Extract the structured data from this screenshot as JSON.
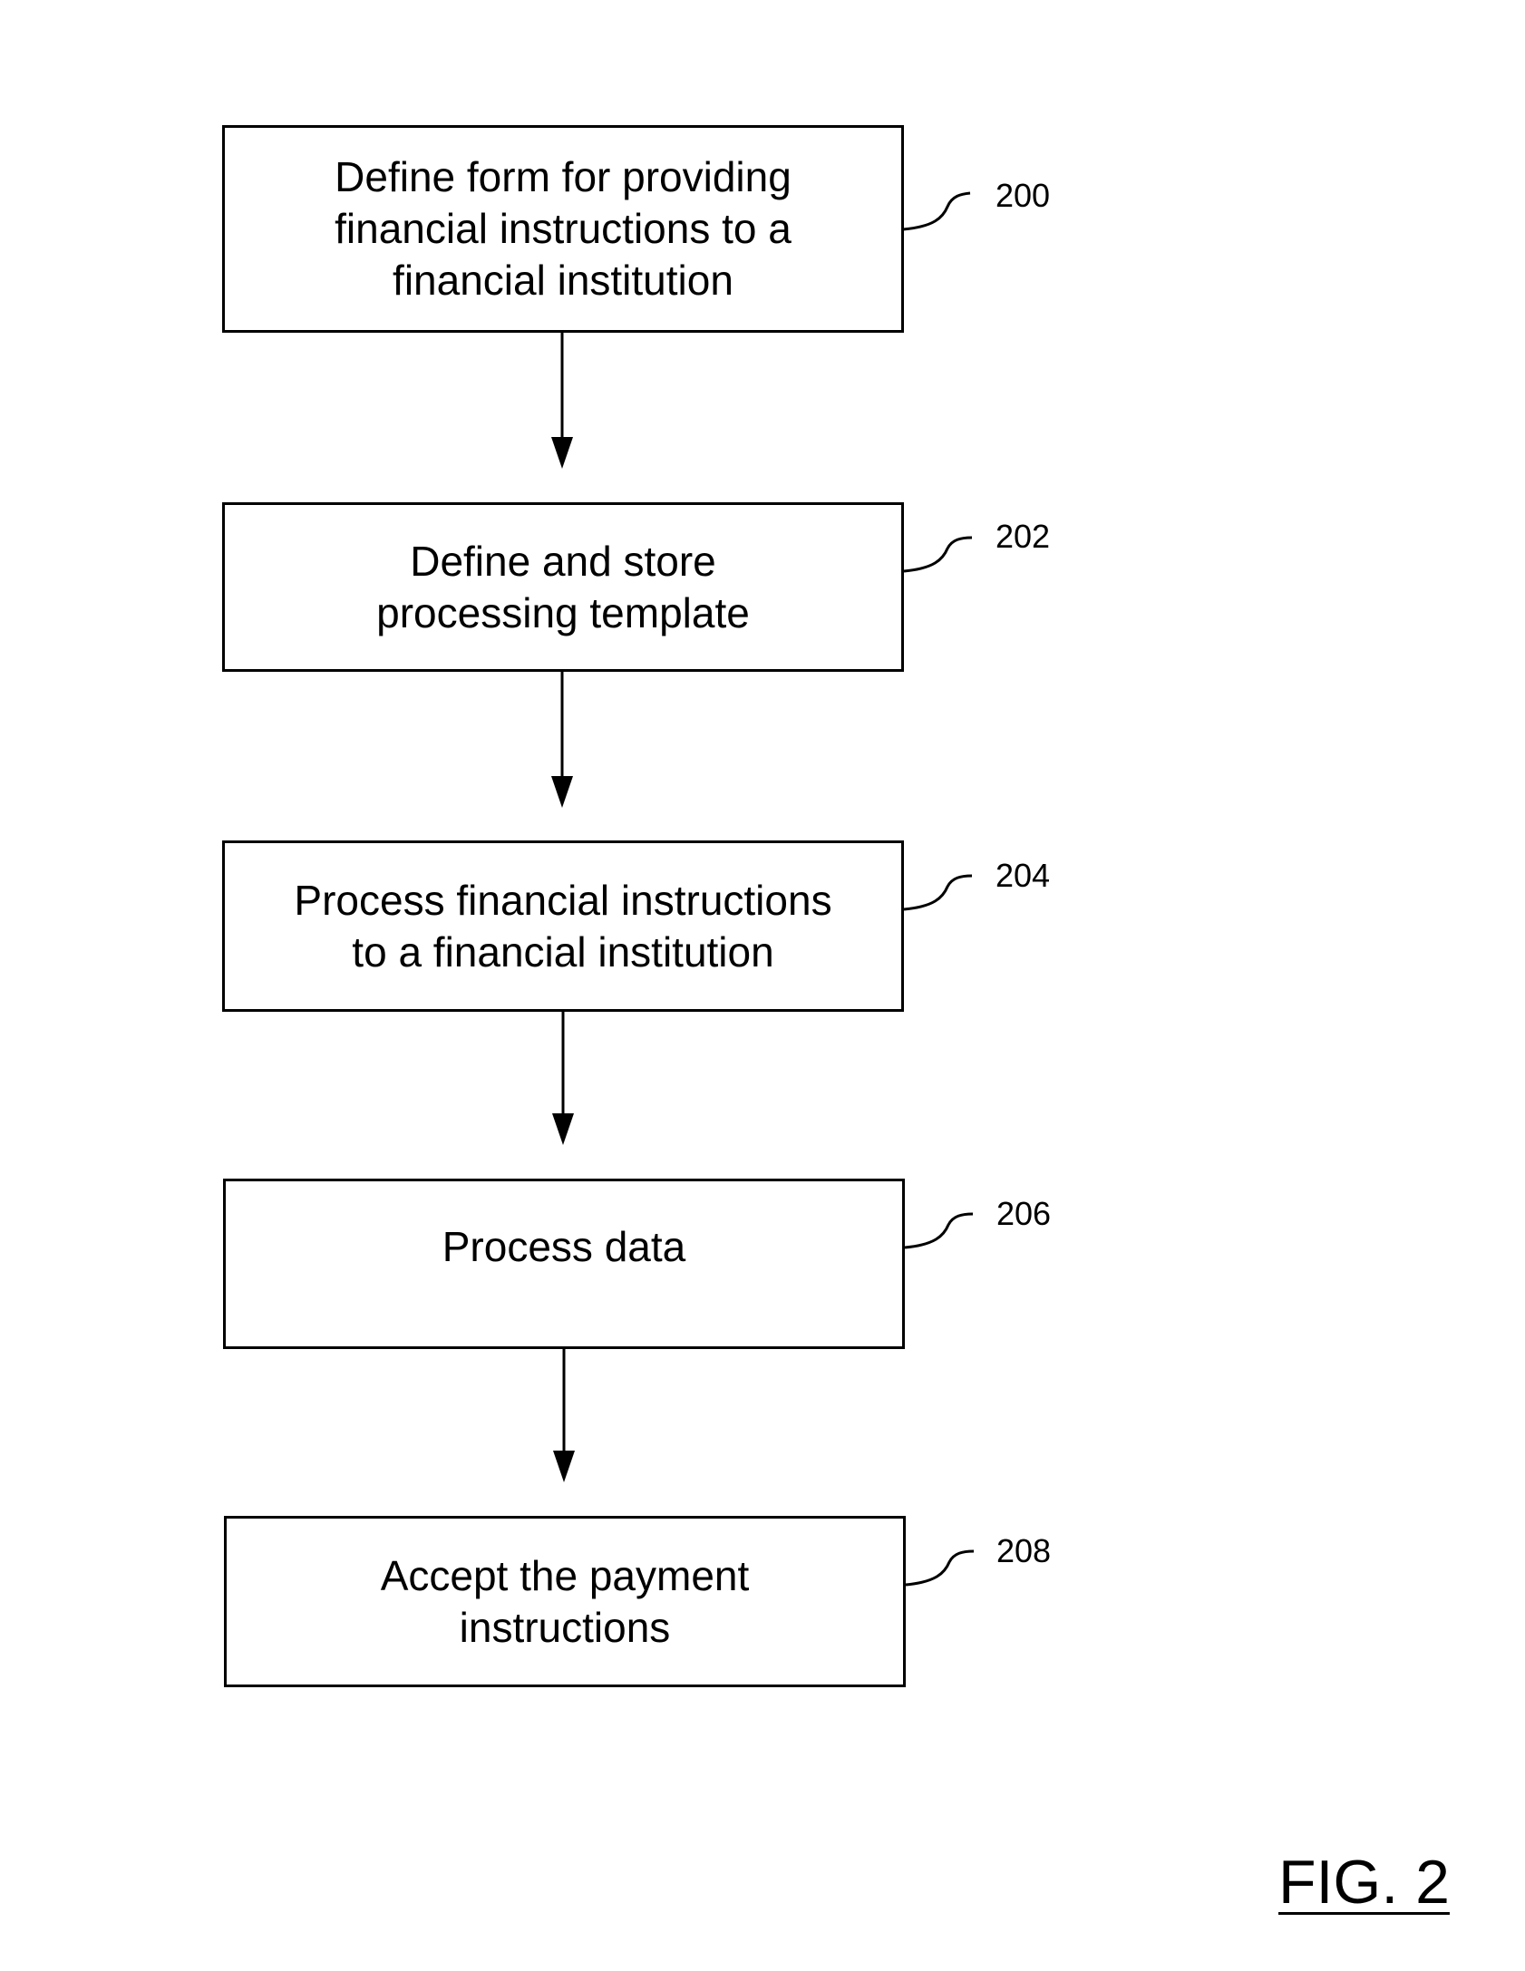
{
  "figure": {
    "label": "FIG. 2",
    "steps": [
      {
        "id": "200",
        "text": "Define form for providing\nfinancial instructions to a\nfinancial institution"
      },
      {
        "id": "202",
        "text": "Define and store\nprocessing template"
      },
      {
        "id": "204",
        "text": "Process financial instructions\nto a financial institution"
      },
      {
        "id": "206",
        "text": "Process data"
      },
      {
        "id": "208",
        "text": "Accept the payment\ninstructions"
      }
    ],
    "flow": [
      {
        "from": "200",
        "to": "202"
      },
      {
        "from": "202",
        "to": "204"
      },
      {
        "from": "204",
        "to": "206"
      },
      {
        "from": "206",
        "to": "208"
      }
    ],
    "colors": {
      "stroke": "#000000",
      "background": "#ffffff"
    }
  }
}
